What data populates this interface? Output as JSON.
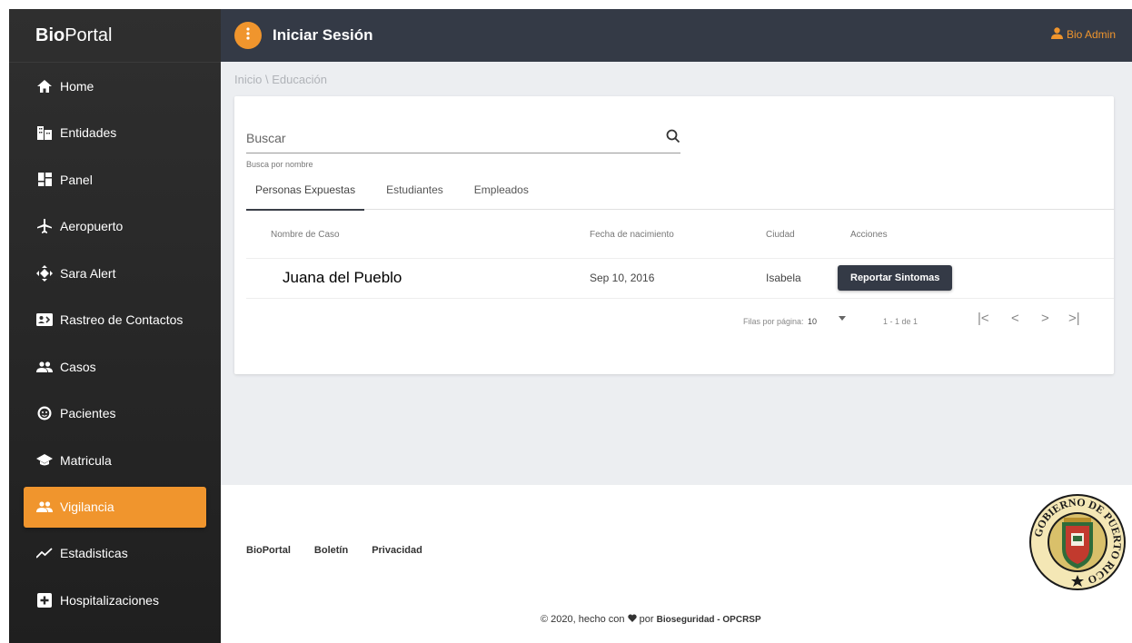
{
  "app": {
    "brand_bold": "Bio",
    "brand_light": "Portal",
    "page_title": "Iniciar Sesión",
    "user_name": "Bio Admin"
  },
  "colors": {
    "accent": "#f0952d",
    "topbar": "#343a46",
    "sidebar": "#2b2b2b",
    "content_bg": "#eceef1"
  },
  "sidebar": {
    "items": [
      {
        "label": "Home",
        "icon": "home-icon"
      },
      {
        "label": "Entidades",
        "icon": "building-icon"
      },
      {
        "label": "Panel",
        "icon": "dashboard-icon"
      },
      {
        "label": "Aeropuerto",
        "icon": "airplane-icon"
      },
      {
        "label": "Sara Alert",
        "icon": "diamond-arrows-icon"
      },
      {
        "label": "Rastreo de Contactos",
        "icon": "contact-card-icon"
      },
      {
        "label": "Casos",
        "icon": "people-icon"
      },
      {
        "label": "Pacientes",
        "icon": "face-icon"
      },
      {
        "label": "Matricula",
        "icon": "graduation-cap-icon"
      },
      {
        "label": "Vigilancia",
        "icon": "people-icon",
        "active": true
      },
      {
        "label": "Estadisticas",
        "icon": "trending-icon"
      },
      {
        "label": "Hospitalizaciones",
        "icon": "plus-box-icon"
      }
    ]
  },
  "breadcrumb": {
    "root": "Inicio",
    "separator": "\\",
    "current": "Educación"
  },
  "search": {
    "placeholder": "Buscar",
    "hint": "Busca por nombre"
  },
  "tabs": [
    {
      "label": "Personas Expuestas",
      "active": true
    },
    {
      "label": "Estudiantes"
    },
    {
      "label": "Empleados"
    }
  ],
  "table": {
    "headers": [
      "Nombre de Caso",
      "Fecha de nacimiento",
      "Ciudad",
      "Acciones"
    ],
    "rows": [
      {
        "name": "Juana del Pueblo",
        "dob": "Sep 10, 2016",
        "city": "Isabela",
        "action": "Reportar Sintomas"
      }
    ]
  },
  "pagination": {
    "rows_label": "Filas por página:",
    "rows_value": "10",
    "range": "1 - 1 de 1"
  },
  "footer": {
    "links": [
      "BioPortal",
      "Boletín",
      "Privacidad"
    ],
    "copyright_prefix": "© 2020, hecho con",
    "copyright_mid": "por",
    "copyright_org": "Bioseguridad - OPCRSP",
    "seal_text": "GOBIERNO DE PUERTO RICO"
  }
}
